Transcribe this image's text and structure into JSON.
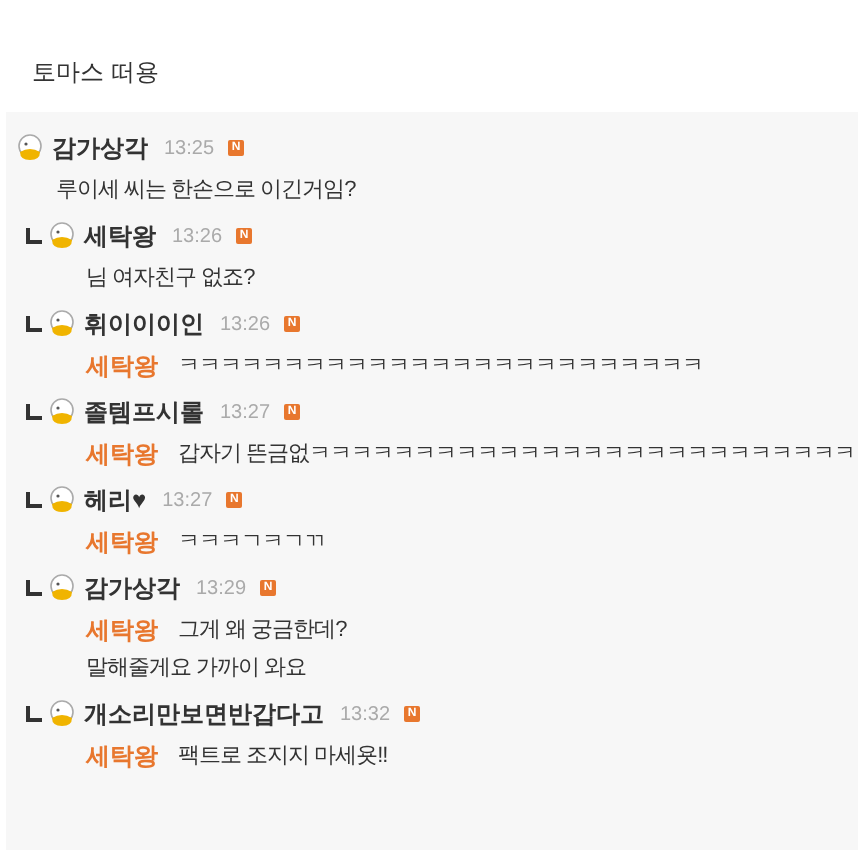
{
  "post_title": "토마스 떠용",
  "comments": [
    {
      "kind": "comment",
      "author": "감가상각",
      "time": "13:25",
      "badge": "N",
      "lines": [
        "루이세 씨는 한손으로 이긴거임?"
      ]
    },
    {
      "kind": "reply",
      "author": "세탁왕",
      "time": "13:26",
      "badge": "N",
      "lines": [
        "님 여자친구 없죠?"
      ]
    },
    {
      "kind": "reply",
      "author": "휘이이이인",
      "time": "13:26",
      "badge": "N",
      "mention": "세탁왕",
      "lines": [
        "ㅋㅋㅋㅋㅋㅋㅋㅋㅋㅋㅋㅋㅋㅋㅋㅋㅋㅋㅋㅋㅋㅋㅋㅋㅋ"
      ]
    },
    {
      "kind": "reply",
      "author": "졸템프시롤",
      "time": "13:27",
      "badge": "N",
      "mention": "세탁왕",
      "lines": [
        "갑자기 뜬금없ㅋㅋㅋㅋㅋㅋㅋㅋㅋㅋㅋㅋㅋㅋㅋㅋㅋㅋㅋㅋㅋㅋㅋㅋㅋㅋ"
      ]
    },
    {
      "kind": "reply",
      "author": "헤리♥",
      "time": "13:27",
      "badge": "N",
      "mention": "세탁왕",
      "lines": [
        "ㅋㅋㅋㄱㅋㄱㄲ"
      ]
    },
    {
      "kind": "reply",
      "author": "감가상각",
      "time": "13:29",
      "badge": "N",
      "mention": "세탁왕",
      "lines": [
        "그게 왜 궁금한데?",
        "말해줄게요 가까이 와요"
      ]
    },
    {
      "kind": "reply",
      "author": "개소리만보면반갑다고",
      "time": "13:32",
      "badge": "N",
      "mention": "세탁왕",
      "lines": [
        "팩트로 조지지 마세욧!!"
      ]
    }
  ]
}
